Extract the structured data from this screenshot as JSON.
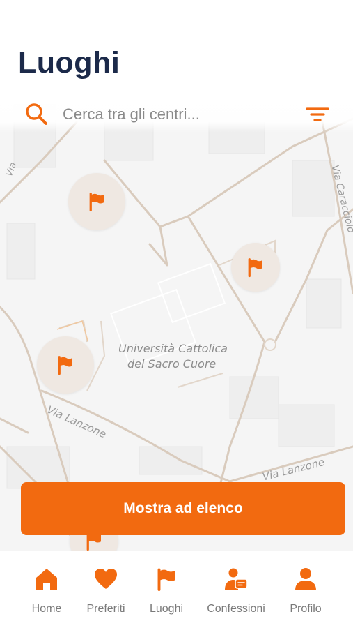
{
  "header": {
    "title": "Luoghi"
  },
  "search": {
    "placeholder": "Cerca tra gli centri..."
  },
  "map": {
    "labels": {
      "university_line1": "Università Cattolica",
      "university_line2": "del Sacro Cuore",
      "street_lanzone_left": "Via Lanzone",
      "street_lanzone_right": "Via Lanzone",
      "street_caracciolo": "Via Caracciolo",
      "street_top_left": "Via"
    },
    "markers": [
      {
        "icon": "flag-icon"
      },
      {
        "icon": "flag-icon"
      },
      {
        "icon": "flag-icon"
      },
      {
        "icon": "flag-icon"
      }
    ]
  },
  "cta": {
    "label": "Mostra ad elenco"
  },
  "nav": {
    "items": [
      {
        "label": "Home",
        "icon": "home-icon"
      },
      {
        "label": "Preferiti",
        "icon": "heart-icon"
      },
      {
        "label": "Luoghi",
        "icon": "flag-icon"
      },
      {
        "label": "Confessioni",
        "icon": "confession-icon"
      },
      {
        "label": "Profilo",
        "icon": "user-icon"
      }
    ]
  },
  "colors": {
    "accent": "#f26a10",
    "title": "#1c2a4a",
    "nav_label": "#7a7a7a",
    "marker_bg": "#efe8e2",
    "road": "#d9cbbd"
  }
}
